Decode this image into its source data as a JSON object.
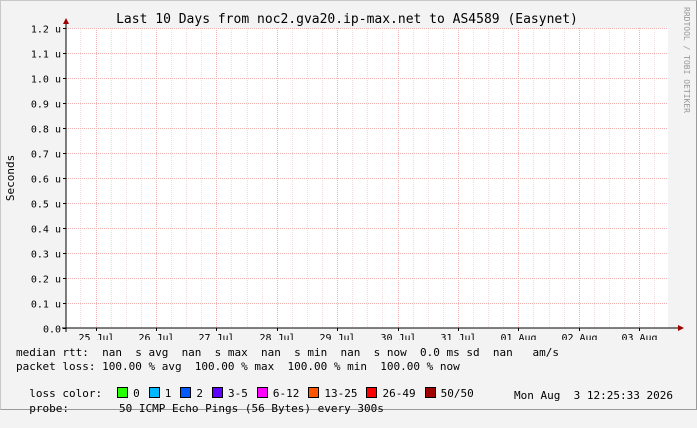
{
  "chart_data": {
    "type": "line",
    "title": "Last 10 Days from noc2.gva20.ip-max.net to AS4589 (Easynet)",
    "ylabel": "Seconds",
    "watermark": "RRDTOOL / TOBI OETIKER",
    "ylim": [
      0,
      1.2
    ],
    "y_ticks": [
      {
        "value": 0.0,
        "label": "0.0"
      },
      {
        "value": 0.1,
        "label": "0.1 u"
      },
      {
        "value": 0.2,
        "label": "0.2 u"
      },
      {
        "value": 0.3,
        "label": "0.3 u"
      },
      {
        "value": 0.4,
        "label": "0.4 u"
      },
      {
        "value": 0.5,
        "label": "0.5 u"
      },
      {
        "value": 0.6,
        "label": "0.6 u"
      },
      {
        "value": 0.7,
        "label": "0.7 u"
      },
      {
        "value": 0.8,
        "label": "0.8 u"
      },
      {
        "value": 0.9,
        "label": "0.9 u"
      },
      {
        "value": 1.0,
        "label": "1.0 u"
      },
      {
        "value": 1.1,
        "label": "1.1 u"
      },
      {
        "value": 1.2,
        "label": "1.2 u"
      }
    ],
    "x_ticks": [
      "25 Jul",
      "26 Jul",
      "27 Jul",
      "28 Jul",
      "29 Jul",
      "30 Jul",
      "31 Jul",
      "01 Aug",
      "02 Aug",
      "03 Aug"
    ],
    "grid": true,
    "series": []
  },
  "legend": {
    "median_rtt": "median rtt:  nan  s avg  nan  s max  nan  s min  nan  s now  0.0 ms sd  nan   am/s",
    "packet_loss": "packet loss: 100.00 % avg  100.00 % max  100.00 % min  100.00 % now",
    "loss_color_label": "loss color:",
    "loss_colors": [
      {
        "label": "0",
        "color": "#26ff00"
      },
      {
        "label": "1",
        "color": "#00b8ff"
      },
      {
        "label": "2",
        "color": "#0059ff"
      },
      {
        "label": "3-5",
        "color": "#5e00ff"
      },
      {
        "label": "6-12",
        "color": "#ff00ff"
      },
      {
        "label": "13-25",
        "color": "#ff5500"
      },
      {
        "label": "26-49",
        "color": "#ff0000"
      },
      {
        "label": "50/50",
        "color": "#a10000"
      }
    ],
    "probe_label": "probe:",
    "probe_text": "50 ICMP Echo Pings (56 Bytes) every 300s",
    "timestamp": "Mon Aug  3 12:25:33 2026"
  }
}
